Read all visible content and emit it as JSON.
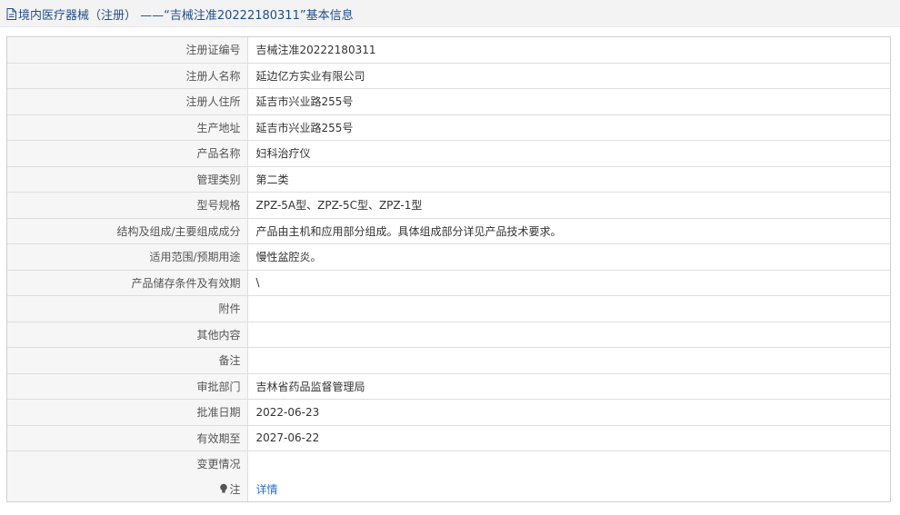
{
  "header": {
    "title": "境内医疗器械（注册） ——“吉械注准20222180311”基本信息"
  },
  "rows": [
    {
      "label": "注册证编号",
      "value": "吉械注准20222180311"
    },
    {
      "label": "注册人名称",
      "value": "延边亿方实业有限公司"
    },
    {
      "label": "注册人住所",
      "value": "延吉市兴业路255号"
    },
    {
      "label": "生产地址",
      "value": "延吉市兴业路255号"
    },
    {
      "label": "产品名称",
      "value": "妇科治疗仪"
    },
    {
      "label": "管理类别",
      "value": "第二类"
    },
    {
      "label": "型号规格",
      "value": "ZPZ-5A型、ZPZ-5C型、ZPZ-1型"
    },
    {
      "label": "结构及组成/主要组成成分",
      "value": "产品由主机和应用部分组成。具体组成部分详见产品技术要求。"
    },
    {
      "label": "适用范围/预期用途",
      "value": "慢性盆腔炎。"
    },
    {
      "label": "产品储存条件及有效期",
      "value": "\\"
    },
    {
      "label": "附件",
      "value": ""
    },
    {
      "label": "其他内容",
      "value": ""
    },
    {
      "label": "备注",
      "value": ""
    },
    {
      "label": "审批部门",
      "value": "吉林省药品监督管理局"
    },
    {
      "label": "批准日期",
      "value": "2022-06-23"
    },
    {
      "label": "有效期至",
      "value": "2027-06-22"
    },
    {
      "label": "变更情况",
      "value": ""
    }
  ],
  "note_row": {
    "label": "注",
    "icon": "bulb-icon",
    "link_text": "详情"
  },
  "colors": {
    "title": "#1f4e8c",
    "link": "#2a6fc9",
    "label_bg": "#f6f6f6",
    "border": "#dedede"
  }
}
